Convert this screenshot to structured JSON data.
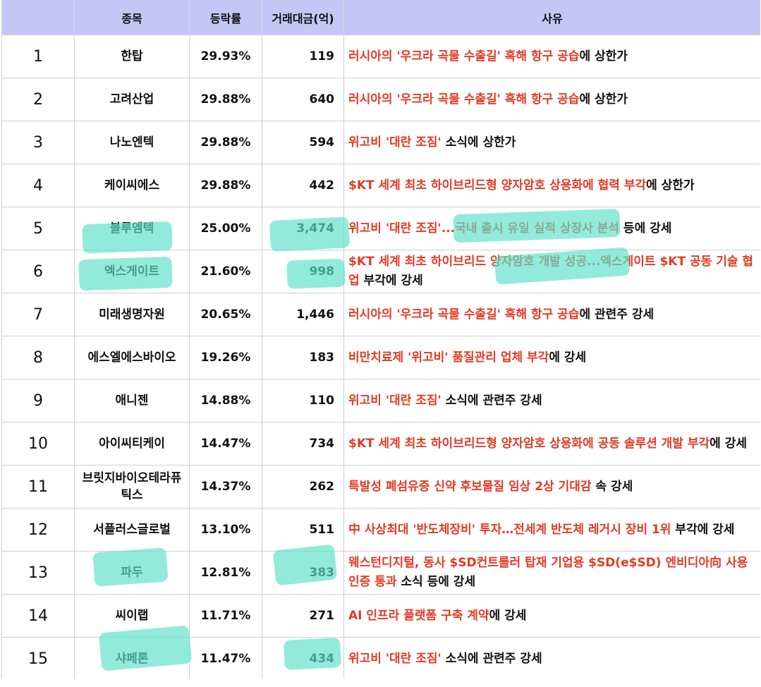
{
  "header": {
    "name": "종목",
    "change": "등락률",
    "amount": "거래대금(억)",
    "reason": "사유"
  },
  "highlight_color": "#5fe0c8",
  "accent_red": "#e23b26",
  "header_bg": "#c6c6f4",
  "rows": [
    {
      "rank": "1",
      "name": "한탑",
      "change": "29.93%",
      "amount": "119",
      "reason_red": "러시아의 '우크라 곡물 수출길' 흑해 항구 공습",
      "reason_black": "에 상한가"
    },
    {
      "rank": "2",
      "name": "고려산업",
      "change": "29.88%",
      "amount": "640",
      "reason_red": "러시아의 '우크라 곡물 수출길' 흑해 항구 공습",
      "reason_black": "에 상한가"
    },
    {
      "rank": "3",
      "name": "나노엔텍",
      "change": "29.88%",
      "amount": "594",
      "reason_red": "위고비 '대란 조짐'",
      "reason_black": " 소식에 상한가"
    },
    {
      "rank": "4",
      "name": "케이씨에스",
      "change": "29.88%",
      "amount": "442",
      "reason_red": "$KT 세계 최초 하이브리드형 양자암호 상용화에 협력 부각",
      "reason_black": "에 상한가"
    },
    {
      "rank": "5",
      "name": "블루엠텍",
      "change": "25.00%",
      "amount": "3,474",
      "reason_red": "위고비 '대란 조짐'...국내 출시 유일 실적 상장사 분석",
      "reason_black": " 등에 강세"
    },
    {
      "rank": "6",
      "name": "엑스게이트",
      "change": "21.60%",
      "amount": "998",
      "reason_red": "$KT 세계 최초 하이브리드 양자암호 개발 성공...엑스게이트 $KT 공동 기술 협업",
      "reason_black": " 부각에 강세"
    },
    {
      "rank": "7",
      "name": "미래생명자원",
      "change": "20.65%",
      "amount": "1,446",
      "reason_red": "러시아의 '우크라 곡물 수출길' 흑해 항구 공습",
      "reason_black": "에 관련주 강세"
    },
    {
      "rank": "8",
      "name": "에스엘에스바이오",
      "change": "19.26%",
      "amount": "183",
      "reason_red": "비만치료제 '위고비' 품질관리 업체 부각",
      "reason_black": "에 강세"
    },
    {
      "rank": "9",
      "name": "애니젠",
      "change": "14.88%",
      "amount": "110",
      "reason_red": "위고비 '대란 조짐'",
      "reason_black": " 소식에 관련주 강세"
    },
    {
      "rank": "10",
      "name": "아이씨티케이",
      "change": "14.47%",
      "amount": "734",
      "reason_red": "$KT 세계 최초 하이브리드형 양자암호 상용화에 공동 솔루션 개발 부각",
      "reason_black": "에 강세"
    },
    {
      "rank": "11",
      "name": "브릿지바이오테라퓨틱스",
      "change": "14.37%",
      "amount": "262",
      "reason_red": "특발성 폐섬유증 신약 후보물질 임상 2상 기대감",
      "reason_black": " 속 강세"
    },
    {
      "rank": "12",
      "name": "서플러스글로벌",
      "change": "13.10%",
      "amount": "511",
      "reason_red": "中 사상최대 '반도체장비' 투자…전세계 반도체 레거시 장비 1위",
      "reason_black": " 부각에 강세"
    },
    {
      "rank": "13",
      "name": "파두",
      "change": "12.81%",
      "amount": "383",
      "reason_red": "웨스턴디지털, 동사 $SD컨트롤러 탑재 기업용 $SD(e$SD) 엔비디아向 사용 인증 통과",
      "reason_black": " 소식 등에  강세"
    },
    {
      "rank": "14",
      "name": "씨이랩",
      "change": "11.71%",
      "amount": "271",
      "reason_red": "AI 인프라 플랫폼 구축 계약",
      "reason_black": "에 강세"
    },
    {
      "rank": "15",
      "name": "샤페론",
      "change": "11.47%",
      "amount": "434",
      "reason_red": "위고비 '대란 조짐'",
      "reason_black": " 소식에 관련주 강세"
    }
  ]
}
